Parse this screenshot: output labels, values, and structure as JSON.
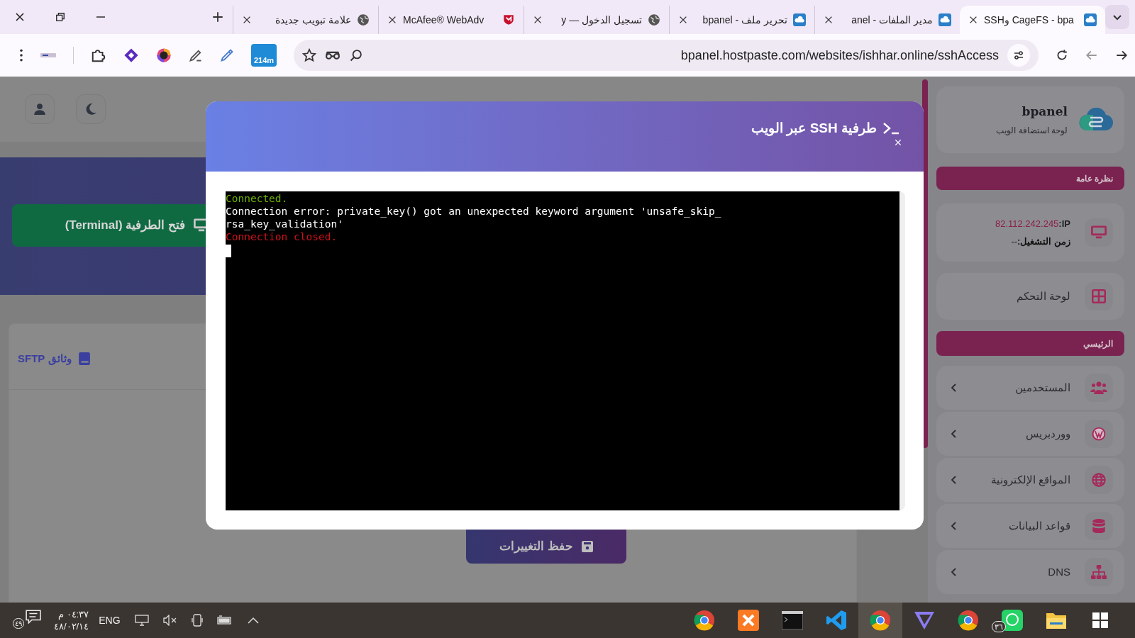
{
  "tabs": [
    {
      "title": "SSHو CageFS - bpa",
      "selected": true
    },
    {
      "title": "مدير الملفات - anel",
      "selected": false
    },
    {
      "title": "تحرير ملف - bpanel",
      "selected": false
    },
    {
      "title": "تسجيل الدخول — y",
      "selected": false
    },
    {
      "title": "McAfee® WebAdv",
      "selected": false
    },
    {
      "title": "علامة تبويب جديدة",
      "selected": false
    }
  ],
  "address_bar": {
    "url": "bpanel.hostpaste.com/websites/ishhar.online/sshAccess"
  },
  "extension_badge": "214m",
  "page": {
    "terminal_button": "فتح الطرفية (Terminal)",
    "sftp_link": "وثائق SFTP",
    "save_button": "حفظ التغييرات"
  },
  "sidebar": {
    "brand": "bpanel",
    "tagline": "لوحة استضافة الويب",
    "overview_header": "نظرة عامة",
    "server_info": {
      "ip_label": "IP:",
      "ip": "82.112.242.245",
      "uptime_label": "زمن التشغيل:",
      "uptime": "--"
    },
    "dashboard": "لوحة التحكم",
    "main_header": "الرئيسي",
    "menu": [
      {
        "label": "المستخدمين"
      },
      {
        "label": "ووردبريس"
      },
      {
        "label": "المواقع الإلكترونية"
      },
      {
        "label": "قواعد البيانات"
      },
      {
        "label": "DNS"
      }
    ]
  },
  "modal": {
    "title": "طرفية SSH عبر الويب",
    "terminal_lines": [
      {
        "kind": "info",
        "text": "Connected."
      },
      {
        "kind": "output",
        "text": "Connection error: private_key() got an unexpected keyword argument 'unsafe_skip_"
      },
      {
        "kind": "output",
        "text": "rsa_key_validation'"
      },
      {
        "kind": "error",
        "text": "Connection closed."
      }
    ]
  },
  "taskbar": {
    "notification_count": "٤٩",
    "time": "٠٤:٣٧ م",
    "date": "٤٨/٠٢/١٤",
    "language": "ENG",
    "whatsapp_badge": "٣٦"
  }
}
